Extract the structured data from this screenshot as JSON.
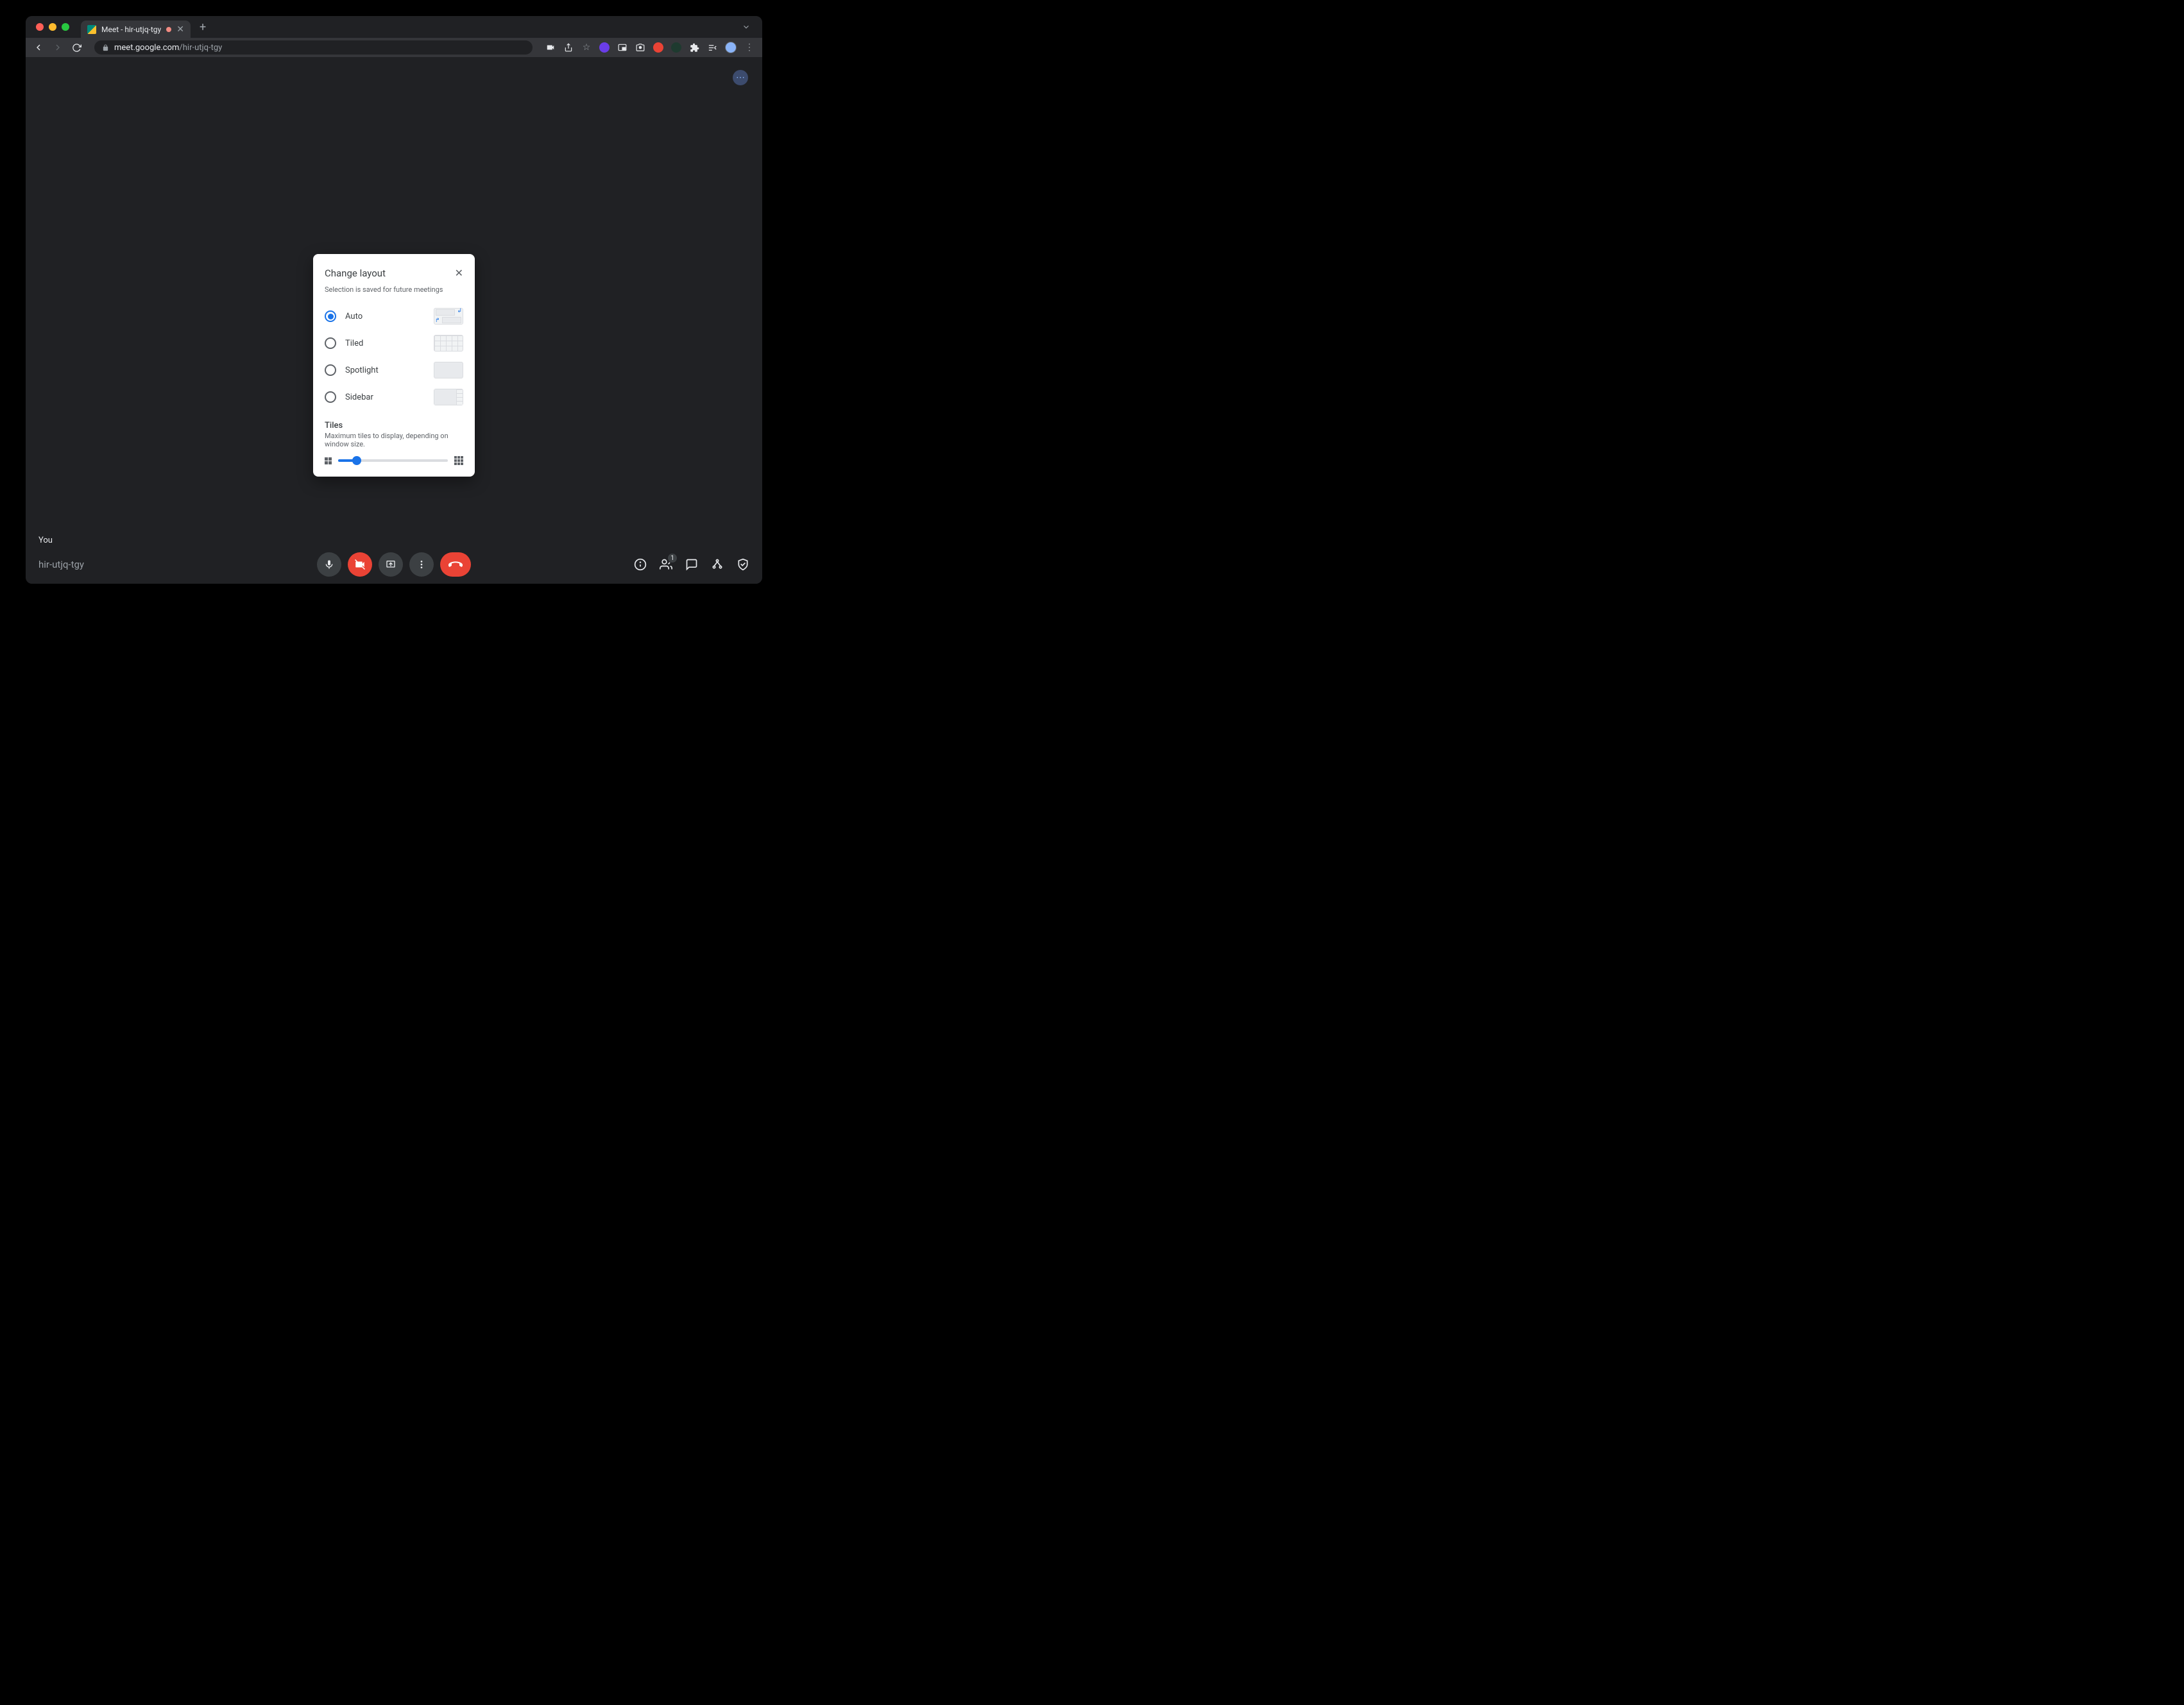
{
  "browser": {
    "tab_title": "Meet - hir-utjq-tgy",
    "url_host": "meet.google.com",
    "url_path": "/hir-utjq-tgy"
  },
  "meet": {
    "you_label": "You",
    "meeting_code": "hir-utjq-tgy",
    "participant_count": "1"
  },
  "dialog": {
    "title": "Change layout",
    "subtitle": "Selection is saved for future meetings",
    "options": [
      {
        "label": "Auto",
        "selected": true
      },
      {
        "label": "Tiled",
        "selected": false
      },
      {
        "label": "Spotlight",
        "selected": false
      },
      {
        "label": "Sidebar",
        "selected": false
      }
    ],
    "tiles_title": "Tiles",
    "tiles_subtitle": "Maximum tiles to display, depending on window size.",
    "slider_percent": 17
  }
}
